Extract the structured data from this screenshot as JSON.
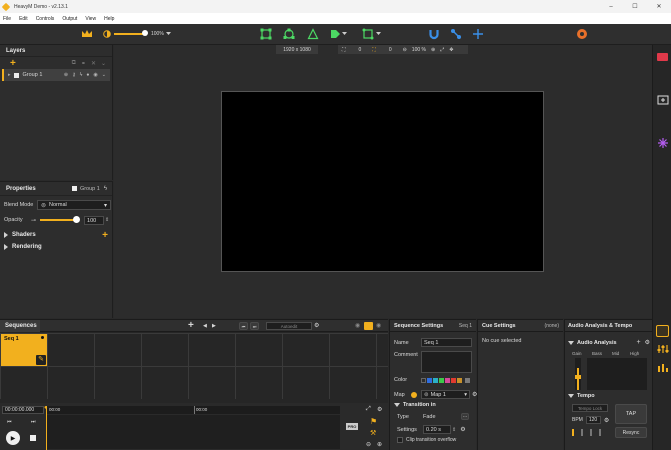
{
  "window": {
    "title": "HeavyM Demo - v2.13.1",
    "controls": [
      "–",
      "☐",
      "✕"
    ]
  },
  "menu": [
    "File",
    "Edit",
    "Controls",
    "Output",
    "View",
    "Help"
  ],
  "toolbar": {
    "opacity_value": "100%"
  },
  "canvas": {
    "resolution": "1920 x 1080",
    "x_value": "0",
    "y_value": "0",
    "zoom_value": "100 %"
  },
  "layers": {
    "title": "Layers",
    "group_name": "Group 1"
  },
  "properties": {
    "title": "Properties",
    "target": "Group 1",
    "blend_label": "Blend Mode",
    "blend_value": "Normal",
    "opacity_label": "Opacity",
    "opacity_value": "100",
    "shaders_label": "Shaders",
    "rendering_label": "Rendering"
  },
  "sequences": {
    "tab_label": "Sequences",
    "autoedit_label": "Autoedit",
    "seq_name": "Seq 1",
    "timecode": "00:00:00.000",
    "ruler": [
      "00:00",
      "00:00"
    ],
    "pro_badge": "PRO"
  },
  "sequence_settings": {
    "title": "Sequence Settings",
    "seq_label": "Seq 1",
    "name_label": "Name",
    "name_value": "Seq 1",
    "comment_label": "Comment",
    "color_label": "Color",
    "map_label": "Map",
    "map_value": "Map 1",
    "transition_in_label": "Transition in",
    "type_label": "Type",
    "type_value": "Fade",
    "settings_label": "Settings",
    "settings_value": "0.20 s",
    "clip_overflow_label": "Clip transition overflow",
    "colors": [
      "#2a2a2a",
      "#2f6ee0",
      "#2bb0c8",
      "#3dc84a",
      "#d64a9b",
      "#e03a2f",
      "#c8902a",
      "#7a7a7a"
    ]
  },
  "cue_settings": {
    "title": "Cue Settings",
    "none_label": "(none)",
    "no_cue_label": "No cue selected"
  },
  "audio": {
    "title": "Audio Analysis & Tempo",
    "analysis_label": "Audio Analysis",
    "bands": [
      "Gain",
      "Bass",
      "Mid",
      "High"
    ],
    "tempo_label": "Tempo",
    "mode_label": "Tempo Lock",
    "bpm_label": "BPM",
    "bpm_value": "120",
    "tap_label": "TAP",
    "resync_label": "Resync"
  },
  "colors": {
    "accent": "#f2b01e",
    "green": "#4cd964",
    "blue": "#3a8fe8",
    "purple": "#b45cf0",
    "red": "#e0394a"
  }
}
